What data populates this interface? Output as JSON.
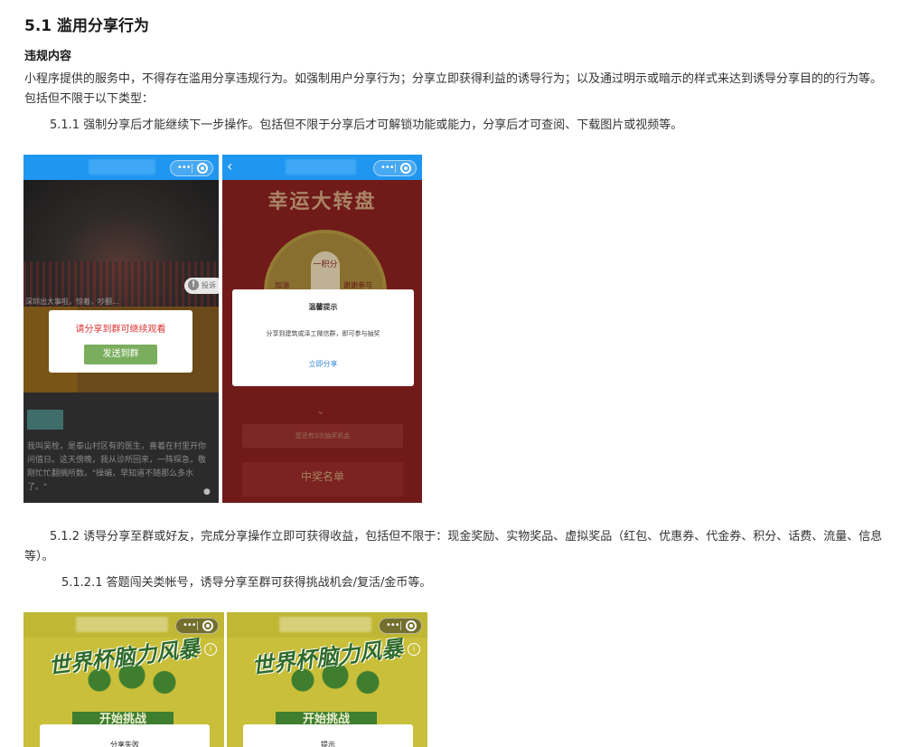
{
  "doc": {
    "section_title": "5.1 滥用分享行为",
    "subheading": "违规内容",
    "para_intro": "小程序提供的服务中，不得存在滥用分享违规行为。如强制用户分享行为；分享立即获得利益的诱导行为；以及通过明示或暗示的样式来达到诱导分享目的的行为等。包括但不限于以下类型：",
    "para_511": "5.1.1 强制分享后才能继续下一步操作。包括但不限于分享后才可解锁功能或能力，分享后才可查阅、下载图片或视频等。",
    "para_512": "5.1.2 诱导分享至群或好友，完成分享操作立即可获得收益，包括但不限于：现金奖励、实物奖品、虚拟奖品（红包、优惠券、代金券、积分、话费、流量、信息等）。",
    "para_5121": "5.1.2.1 答题闯关类帐号，诱导分享至群可获得挑战机会/复活/金币等。"
  },
  "screenshots": {
    "shot1": {
      "capsule_more": "•••",
      "caption": "深圳出大事啦，惊着，吵翻...",
      "report_label": "投诉",
      "modal_text": "请分享到群可继续观看",
      "modal_button": "发送到群",
      "story_text": "我叫吴栓，是泰山村区有的医生，喜着在村里开你问值日。这天傍晚，我从诊所回来，一阵探急，敬刚忙忙翻搁所数。\"操编，早知道不随那么多水了。\""
    },
    "shot2": {
      "capsule_more": "•••",
      "back": "‹",
      "title": "幸运大转盘",
      "wheel_center": "一积分",
      "wheel_left": "加油",
      "wheel_right": "谢谢参与",
      "modal_title": "温馨提示",
      "modal_body": "分享到建筑或泽工微信群，即可参与抽奖",
      "modal_link": "立即分享",
      "chevron": "⌄",
      "row_text": "您还有3次抽奖机会",
      "winners": "中奖名单"
    },
    "shot3": {
      "capsule_more": "•••",
      "title": "世界杯脑力风暴",
      "start": "开始挑战",
      "info": "i",
      "sheet_title": "分享失败"
    },
    "shot4": {
      "capsule_more": "•••",
      "title": "世界杯脑力风暴",
      "start": "开始挑战",
      "info": "i",
      "sheet_title": "提示"
    }
  },
  "colors": {
    "navbar_blue": "#1f96f0",
    "modal_red_text": "#dd3333",
    "modal_button_green": "#7aae5e",
    "link_blue": "#3a8ad8",
    "lottery_red": "#8a2020",
    "worldcup_yellow": "#c9bf3a"
  }
}
